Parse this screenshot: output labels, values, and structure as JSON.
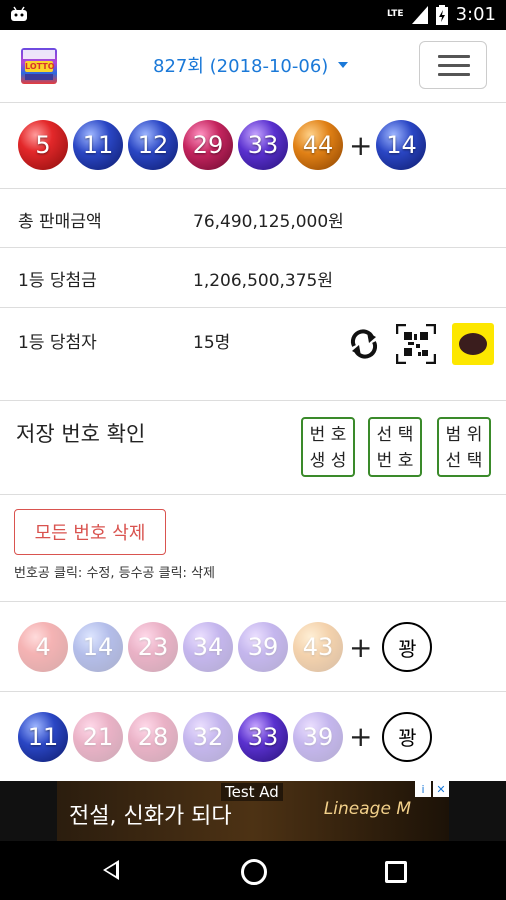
{
  "status_bar": {
    "time": "3:01",
    "network": "LTE",
    "battery_icon": "battery-icon",
    "signal_icon": "signal-icon",
    "android_icon": "android-icon"
  },
  "header": {
    "logo_text_top": "",
    "logo_text_mid": "LOTTO",
    "round_label": "827회 (2018-10-06)",
    "menu_icon": "hamburger-icon"
  },
  "winning_numbers": {
    "main": [
      {
        "n": "5",
        "color": "red"
      },
      {
        "n": "11",
        "color": "blue"
      },
      {
        "n": "12",
        "color": "blue"
      },
      {
        "n": "29",
        "color": "magenta"
      },
      {
        "n": "33",
        "color": "purple"
      },
      {
        "n": "44",
        "color": "orange"
      }
    ],
    "plus": "+",
    "bonus": {
      "n": "14",
      "color": "blue"
    }
  },
  "info": {
    "total_sales_label": "총 판매금액",
    "total_sales_value": "76,490,125,000원",
    "first_prize_label": "1등 당첨금",
    "first_prize_value": "1,206,500,375원",
    "first_winners_label": "1등 당첨자",
    "first_winners_value": "15명"
  },
  "saved": {
    "title": "저장 번호 확인",
    "btn_generate_line1": "번 호",
    "btn_generate_line2": "생 성",
    "btn_select_line1": "선 택",
    "btn_select_line2": "번 호",
    "btn_range_line1": "범 위",
    "btn_range_line2": "선 택",
    "delete_all": "모든 번호 삭제",
    "hint": "번호공 클릭: 수정, 등수공 클릭: 삭제"
  },
  "saved_rows": [
    {
      "balls": [
        {
          "n": "4",
          "color": "red",
          "faint": true
        },
        {
          "n": "14",
          "color": "blue",
          "faint": true
        },
        {
          "n": "23",
          "color": "magenta",
          "faint": true
        },
        {
          "n": "34",
          "color": "purple",
          "faint": true
        },
        {
          "n": "39",
          "color": "purple",
          "faint": true
        },
        {
          "n": "43",
          "color": "orange",
          "faint": true
        }
      ],
      "plus": "+",
      "result": "꽝"
    },
    {
      "balls": [
        {
          "n": "11",
          "color": "blue",
          "faint": false
        },
        {
          "n": "21",
          "color": "magenta",
          "faint": true
        },
        {
          "n": "28",
          "color": "magenta",
          "faint": true
        },
        {
          "n": "32",
          "color": "purple",
          "faint": true
        },
        {
          "n": "33",
          "color": "purple",
          "faint": false
        },
        {
          "n": "39",
          "color": "purple",
          "faint": true
        }
      ],
      "plus": "+",
      "result": "꽝"
    }
  ],
  "ad": {
    "label": "Test Ad",
    "text": "전설, 신화가 되다",
    "brand": "Lineage M",
    "info_icon": "i",
    "close_icon": "✕"
  }
}
